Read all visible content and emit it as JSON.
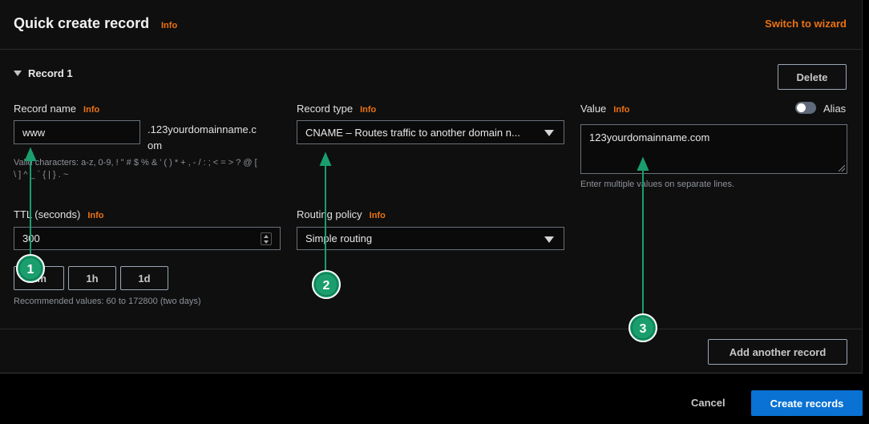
{
  "header": {
    "title": "Quick create record",
    "info": "Info",
    "switch_link": "Switch to wizard"
  },
  "record": {
    "toggle_label": "Record 1",
    "delete_label": "Delete",
    "name": {
      "label": "Record name",
      "info": "Info",
      "value": "www",
      "suffix_line1": ".123yourdomainname.c",
      "suffix_line2": "om",
      "hint_line1": "Valid characters: a-z, 0-9, ! \" # $ % & ' ( ) * + , - / : ; < = > ? @ [",
      "hint_line2": "\\ ] ^ _ ` { | } . ~"
    },
    "type": {
      "label": "Record type",
      "info": "Info",
      "value": "CNAME – Routes traffic to another domain n..."
    },
    "value": {
      "label": "Value",
      "info": "Info",
      "text": "123yourdomainname.com",
      "hint": "Enter multiple values on separate lines.",
      "alias_label": "Alias",
      "alias_on": false
    },
    "ttl": {
      "label": "TTL (seconds)",
      "info": "Info",
      "value": "300",
      "presets": [
        "1m",
        "1h",
        "1d"
      ],
      "hint": "Recommended values: 60 to 172800 (two days)"
    },
    "routing": {
      "label": "Routing policy",
      "info": "Info",
      "value": "Simple routing"
    }
  },
  "footer": {
    "add_label": "Add another record",
    "cancel_label": "Cancel",
    "create_label": "Create records"
  },
  "annotations": [
    "1",
    "2",
    "3"
  ],
  "colors": {
    "accent": "#ec7211",
    "primary": "#0972d3",
    "annotation": "#1a9e6e"
  }
}
